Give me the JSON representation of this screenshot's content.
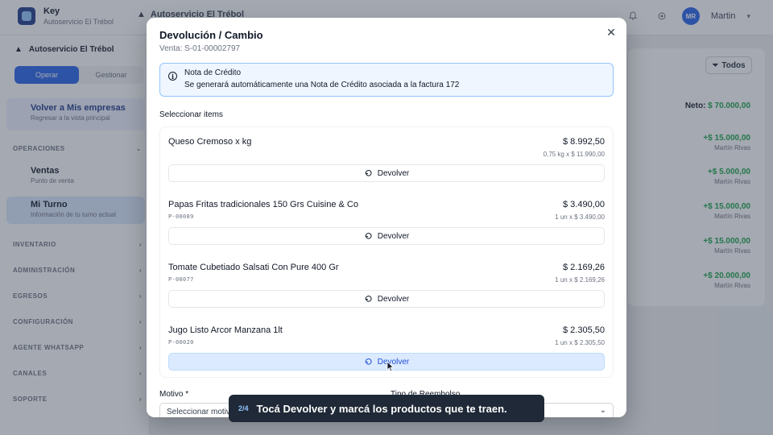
{
  "app": {
    "brand_name": "Key",
    "brand_sub": "Autoservicio El Trébol",
    "store_chip": "Autoservicio El Trébol",
    "user_initials": "MR",
    "user_name": "Martin"
  },
  "sidebar": {
    "store": "Autoservicio El Trébol",
    "toggle": [
      "Operar",
      "Gestionar"
    ],
    "back_title": "Volver a Mis empresas",
    "back_sub": "Regresar a la vista principal",
    "sections": [
      "OPERACIONES",
      "INVENTARIO",
      "ADMINISTRACIÓN",
      "EGRESOS",
      "CONFIGURACIÓN",
      "AGENTE WHATSAPP",
      "CANALES",
      "SOPORTE"
    ],
    "items": [
      {
        "title": "Ventas",
        "sub": "Punto de venta"
      },
      {
        "title": "Mi Turno",
        "sub": "Información de tu turno actual"
      }
    ]
  },
  "main": {
    "filter_label": "Todos",
    "neto_label": "Neto:",
    "neto_value": "$ 70.000,00",
    "rows": [
      {
        "amount": "+$ 15.000,00",
        "user": "Martín Rivas"
      },
      {
        "amount": "+$ 5.000,00",
        "user": "Martín Rivas"
      },
      {
        "amount": "+$ 15.000,00",
        "user": "Martín Rivas"
      },
      {
        "amount": "+$ 15.000,00",
        "user": "Martín Rivas"
      },
      {
        "amount": "+$ 20.000,00",
        "user": "Martín Rivas"
      }
    ]
  },
  "modal": {
    "title": "Devolución / Cambio",
    "subtitle": "Venta: S-01-00002797",
    "info_title": "Nota de Crédito",
    "info_text": "Se generará automáticamente una Nota de Crédito asociada a la factura 172",
    "select_label": "Seleccionar items",
    "items": [
      {
        "name": "Queso Cremoso x kg",
        "sku": "",
        "price": "$ 8.992,50",
        "detail": "0,75 kg x $ 11.990,00",
        "button": "Devolver"
      },
      {
        "name": "Papas Fritas tradicionales 150 Grs Cuisine & Co",
        "sku": "P-00089",
        "price": "$ 3.490,00",
        "detail": "1 un x $ 3.490,00",
        "button": "Devolver"
      },
      {
        "name": "Tomate Cubetiado Salsati Con Pure 400 Gr",
        "sku": "P-00077",
        "price": "$ 2.169,26",
        "detail": "1 un x $ 2.169,26",
        "button": "Devolver"
      },
      {
        "name": "Jugo Listo Arcor Manzana 1lt",
        "sku": "P-00020",
        "price": "$ 2.305,50",
        "detail": "1 un x $ 2.305,50",
        "button": "Devolver"
      }
    ],
    "motivo_label": "Motivo *",
    "motivo_placeholder": "Seleccionar motivo",
    "tipo_label": "Tipo de Reembolso"
  },
  "tooltip": {
    "step": "2/4",
    "message": "Tocá Devolver y marcá los productos que te traen."
  },
  "colors": {
    "accent": "#2563eb",
    "positive": "#16a34a",
    "info_border": "#93c5fd",
    "tooltip_bg": "#1f2937"
  }
}
